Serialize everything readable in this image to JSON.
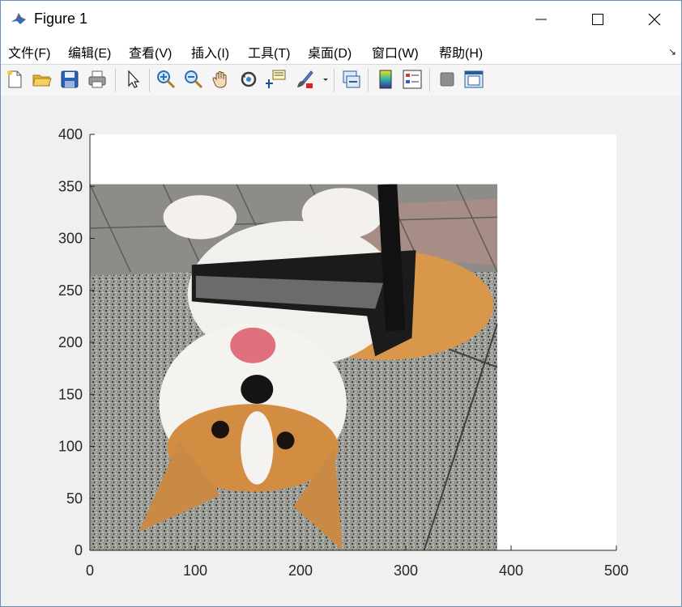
{
  "window": {
    "title": "Figure 1"
  },
  "menu": {
    "items": [
      {
        "label": "文件(F)"
      },
      {
        "label": "编辑(E)"
      },
      {
        "label": "查看(V)"
      },
      {
        "label": "插入(I)"
      },
      {
        "label": "工具(T)"
      },
      {
        "label": "桌面(D)"
      },
      {
        "label": "窗口(W)"
      },
      {
        "label": "帮助(H)"
      }
    ]
  },
  "toolbar": {
    "icons": [
      "new-figure-icon",
      "open-file-icon",
      "save-icon",
      "print-icon",
      "select-arrow-icon",
      "zoom-in-icon",
      "zoom-out-icon",
      "pan-hand-icon",
      "rotate-3d-icon",
      "data-cursor-icon",
      "brush-icon",
      "brush-dropdown-icon",
      "link-plot-icon",
      "insert-colorbar-icon",
      "insert-legend-icon",
      "hide-plot-tools-icon",
      "show-plot-tools-icon"
    ]
  },
  "chart_data": {
    "type": "image",
    "image_content": "corgi dog photo, rotated upside down, lying on granite floor",
    "image_extent": {
      "x": [
        0,
        387
      ],
      "y": [
        0,
        352
      ]
    },
    "xlim": [
      0,
      500
    ],
    "ylim": [
      0,
      400
    ],
    "xticks": [
      0,
      100,
      200,
      300,
      400,
      500
    ],
    "yticks": [
      0,
      50,
      100,
      150,
      200,
      250,
      300,
      350,
      400
    ],
    "xlabel": "",
    "ylabel": "",
    "title": "",
    "grid": false,
    "axes_background": "#ffffff"
  },
  "colors": {
    "accent": "#0072bd",
    "window_border": "#6d8fb4"
  }
}
